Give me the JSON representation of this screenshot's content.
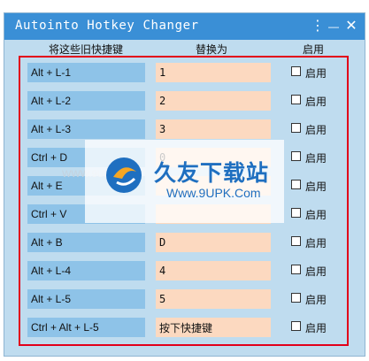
{
  "window": {
    "title": "Autointo Hotkey Changer",
    "menu_icon": "⋮",
    "minimize_icon": "—",
    "close_icon": "✕"
  },
  "headers": {
    "original": "将这些旧快捷键",
    "replace": "替换为",
    "enable": "启用"
  },
  "rows": [
    {
      "key": "Alt + L-1",
      "value": "1",
      "enable_label": "启用"
    },
    {
      "key": "Alt + L-2",
      "value": "2",
      "enable_label": "启用"
    },
    {
      "key": "Alt + L-3",
      "value": "3",
      "enable_label": "启用"
    },
    {
      "key": "Ctrl + D",
      "value": "0",
      "enable_label": "启用"
    },
    {
      "key": "Alt + E",
      "value": "",
      "enable_label": "启用"
    },
    {
      "key": "Ctrl + V",
      "value": "",
      "enable_label": "启用"
    },
    {
      "key": "Alt + B",
      "value": "D",
      "enable_label": "启用"
    },
    {
      "key": "Alt + L-4",
      "value": "4",
      "enable_label": "启用"
    },
    {
      "key": "Alt + L-5",
      "value": "5",
      "enable_label": "启用"
    },
    {
      "key": "Ctrl + Alt + L-5",
      "value": "按下快捷键",
      "enable_label": "启用"
    }
  ],
  "watermark": {
    "brand": "久友下载站",
    "url": "Www.9UPK.Com",
    "left_text": "WWW.9UPK.COM"
  },
  "colors": {
    "titlebar": "#3a8fd6",
    "key_bg": "#8ec3e8",
    "value_bg": "#fcd9c0",
    "highlight_frame": "#e2001a"
  }
}
